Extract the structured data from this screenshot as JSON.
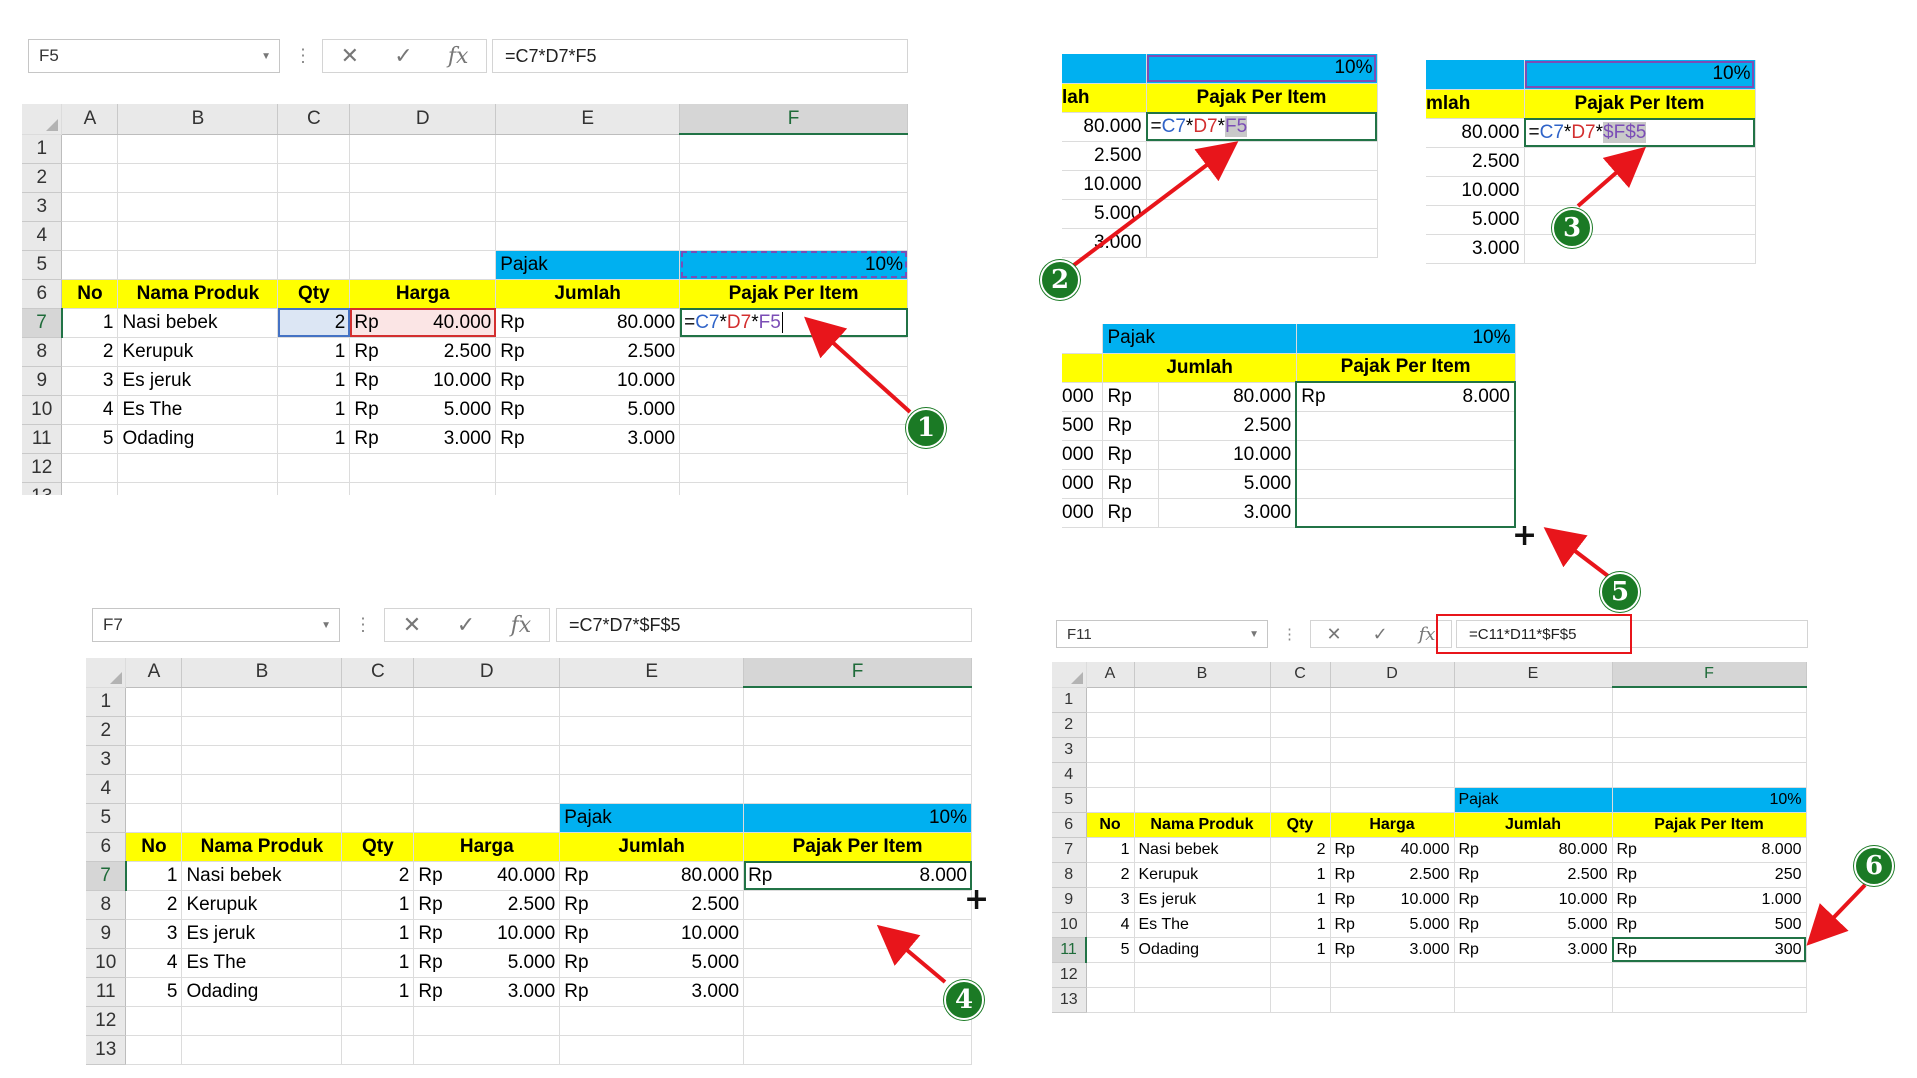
{
  "p1": {
    "namebox": "F5",
    "formula": "=C7*D7*F5",
    "cols": [
      "A",
      "B",
      "C",
      "D",
      "E",
      "F"
    ],
    "rows": [
      "1",
      "2",
      "3",
      "4",
      "5",
      "6",
      "7",
      "8",
      "9",
      "10",
      "11",
      "12",
      "13"
    ],
    "pajak_label": "Pajak",
    "pajak_rate": "10%",
    "headers": {
      "no": "No",
      "nama": "Nama Produk",
      "qty": "Qty",
      "harga": "Harga",
      "jumlah": "Jumlah",
      "pajak": "Pajak Per Item"
    },
    "items": [
      {
        "no": "1",
        "nama": "Nasi bebek",
        "qty": "2",
        "rp": "Rp",
        "harga": "40.000",
        "jumlah": "80.000"
      },
      {
        "no": "2",
        "nama": "Kerupuk",
        "qty": "1",
        "rp": "Rp",
        "harga": "2.500",
        "jumlah": "2.500"
      },
      {
        "no": "3",
        "nama": "Es jeruk",
        "qty": "1",
        "rp": "Rp",
        "harga": "10.000",
        "jumlah": "10.000"
      },
      {
        "no": "4",
        "nama": "Es The",
        "qty": "1",
        "rp": "Rp",
        "harga": "5.000",
        "jumlah": "5.000"
      },
      {
        "no": "5",
        "nama": "Odading",
        "qty": "1",
        "rp": "Rp",
        "harga": "3.000",
        "jumlah": "3.000"
      }
    ],
    "edit": {
      "eq": "=",
      "c7": "C7",
      "star1": "*",
      "d7": "D7",
      "star2": "*",
      "f5": "F5"
    }
  },
  "p2": {
    "rate": "10%",
    "hdr_left": "lah",
    "hdr": "Pajak Per Item",
    "values": [
      "80.000",
      "2.500",
      "10.000",
      "5.000",
      "3.000"
    ],
    "edit": {
      "eq": "=",
      "c7": "C7",
      "star1": "*",
      "d7": "D7",
      "star2": "*",
      "f5": "F5"
    }
  },
  "p3": {
    "rate": "10%",
    "hdr_left": "mlah",
    "hdr": "Pajak Per Item",
    "values": [
      "80.000",
      "2.500",
      "10.000",
      "5.000",
      "3.000"
    ],
    "edit": {
      "eq": "=",
      "c7": "C7",
      "star1": "*",
      "d7": "D7",
      "star2": "*",
      "f5": "$F$5"
    }
  },
  "p5": {
    "pajak_label": "Pajak",
    "rate": "10%",
    "hdr_jumlah": "Jumlah",
    "hdr_pajak": "Pajak Per Item",
    "left_frag": [
      "000",
      "500",
      "000",
      "000",
      "000"
    ],
    "rp": "Rp",
    "jumlah": [
      "80.000",
      "2.500",
      "10.000",
      "5.000",
      "3.000"
    ],
    "f7": {
      "rp": "Rp",
      "val": "8.000"
    }
  },
  "p4": {
    "namebox": "F7",
    "formula": "=C7*D7*$F$5",
    "cols": [
      "A",
      "B",
      "C",
      "D",
      "E",
      "F"
    ],
    "rows": [
      "1",
      "2",
      "3",
      "4",
      "5",
      "6",
      "7",
      "8",
      "9",
      "10",
      "11",
      "12",
      "13"
    ],
    "pajak_label": "Pajak",
    "pajak_rate": "10%",
    "headers": {
      "no": "No",
      "nama": "Nama Produk",
      "qty": "Qty",
      "harga": "Harga",
      "jumlah": "Jumlah",
      "pajak": "Pajak Per Item"
    },
    "items": [
      {
        "no": "1",
        "nama": "Nasi bebek",
        "qty": "2",
        "rp": "Rp",
        "harga": "40.000",
        "jumlah": "80.000"
      },
      {
        "no": "2",
        "nama": "Kerupuk",
        "qty": "1",
        "rp": "Rp",
        "harga": "2.500",
        "jumlah": "2.500"
      },
      {
        "no": "3",
        "nama": "Es jeruk",
        "qty": "1",
        "rp": "Rp",
        "harga": "10.000",
        "jumlah": "10.000"
      },
      {
        "no": "4",
        "nama": "Es The",
        "qty": "1",
        "rp": "Rp",
        "harga": "5.000",
        "jumlah": "5.000"
      },
      {
        "no": "5",
        "nama": "Odading",
        "qty": "1",
        "rp": "Rp",
        "harga": "3.000",
        "jumlah": "3.000"
      }
    ],
    "f7": {
      "rp": "Rp",
      "val": "8.000"
    }
  },
  "p6": {
    "namebox": "F11",
    "formula": "=C11*D11*$F$5",
    "cols": [
      "A",
      "B",
      "C",
      "D",
      "E",
      "F"
    ],
    "rows": [
      "1",
      "2",
      "3",
      "4",
      "5",
      "6",
      "7",
      "8",
      "9",
      "10",
      "11",
      "12",
      "13"
    ],
    "pajak_label": "Pajak",
    "pajak_rate": "10%",
    "headers": {
      "no": "No",
      "nama": "Nama Produk",
      "qty": "Qty",
      "harga": "Harga",
      "jumlah": "Jumlah",
      "pajak": "Pajak Per Item"
    },
    "items": [
      {
        "no": "1",
        "nama": "Nasi bebek",
        "qty": "2",
        "rp": "Rp",
        "harga": "40.000",
        "jumlah": "80.000",
        "pajak": "8.000"
      },
      {
        "no": "2",
        "nama": "Kerupuk",
        "qty": "1",
        "rp": "Rp",
        "harga": "2.500",
        "jumlah": "2.500",
        "pajak": "250"
      },
      {
        "no": "3",
        "nama": "Es jeruk",
        "qty": "1",
        "rp": "Rp",
        "harga": "10.000",
        "jumlah": "10.000",
        "pajak": "1.000"
      },
      {
        "no": "4",
        "nama": "Es The",
        "qty": "1",
        "rp": "Rp",
        "harga": "5.000",
        "jumlah": "5.000",
        "pajak": "500"
      },
      {
        "no": "5",
        "nama": "Odading",
        "qty": "1",
        "rp": "Rp",
        "harga": "3.000",
        "jumlah": "3.000",
        "pajak": "300"
      }
    ]
  },
  "badges": [
    "1",
    "2",
    "3",
    "4",
    "5",
    "6"
  ],
  "colors": {
    "yellow": "#ffff00",
    "blue": "#00b0f0",
    "green": "#217346",
    "badge": "#1b7a25",
    "arrow": "#e8151b"
  }
}
